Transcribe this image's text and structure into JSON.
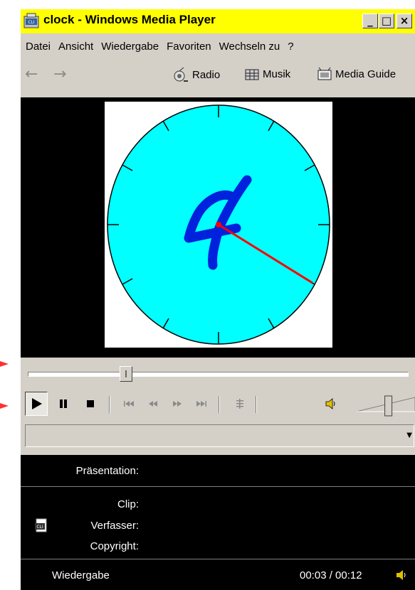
{
  "window": {
    "title": "clock - Windows Media Player",
    "titlebar_color": "#ffff00",
    "controls": {
      "minimize": "_",
      "maximize": "□",
      "close": "×"
    }
  },
  "menu": {
    "items": [
      "Datei",
      "Ansicht",
      "Wiedergabe",
      "Favoriten",
      "Wechseln zu",
      "?"
    ]
  },
  "nav": {
    "back_icon": "←",
    "forward_icon": "→",
    "radio_label": "Radio",
    "music_label": "Musik",
    "guide_label": "Media Guide"
  },
  "video": {
    "clock_face_color": "#00ffff",
    "digit": "4",
    "digit_color": "#0022dd",
    "hand_color": "#ff0000"
  },
  "playback": {
    "seek_position_fraction": 0.25,
    "volume_fraction": 0.55
  },
  "info": {
    "presentation_label": "Präsentation:",
    "clip_label": "Clip:",
    "author_label": "Verfasser:",
    "copyright_label": "Copyright:",
    "status": "Wiedergabe",
    "time": "00:03 / 00:12"
  }
}
